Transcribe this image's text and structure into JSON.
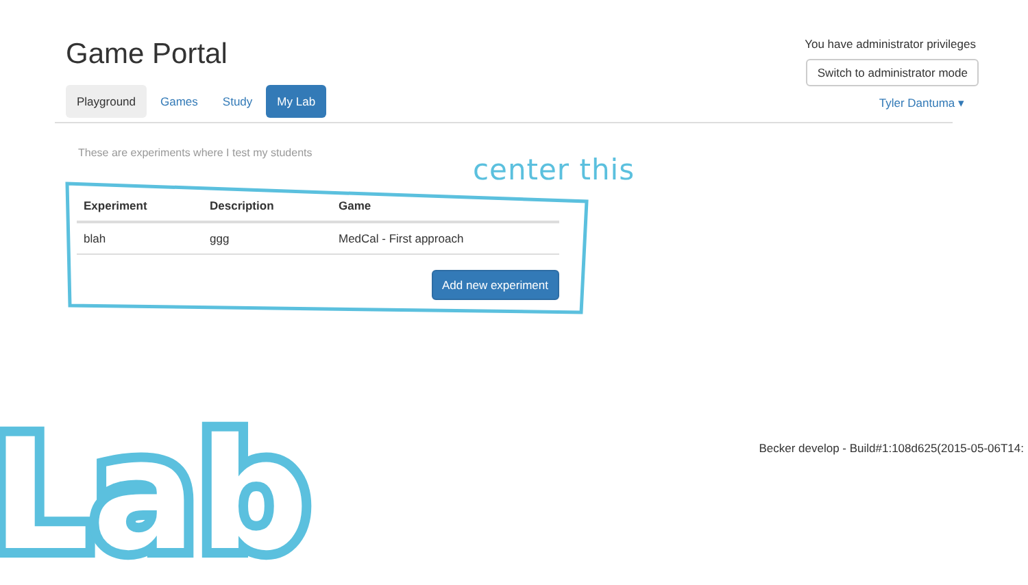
{
  "header": {
    "title": "Game Portal",
    "admin_notice": "You have administrator privileges",
    "admin_button": "Switch to administrator mode",
    "user_menu": "Tyler Dantuma",
    "user_caret": "▾"
  },
  "tabs": [
    {
      "label": "Playground",
      "selected": false,
      "hovered": true
    },
    {
      "label": "Games",
      "selected": false,
      "hovered": false
    },
    {
      "label": "Study",
      "selected": false,
      "hovered": false
    },
    {
      "label": "My Lab",
      "selected": true,
      "hovered": false
    }
  ],
  "intro": "These are experiments where I test my students",
  "table": {
    "columns": [
      "Experiment",
      "Description",
      "Game"
    ],
    "rows": [
      [
        "blah",
        "ggg",
        "MedCal - First approach"
      ]
    ]
  },
  "add_button": "Add new experiment",
  "footer": "Becker develop - Build#1:108d625(2015-05-06T14:",
  "annotations": {
    "note": "center this",
    "big_label": "Lab"
  }
}
